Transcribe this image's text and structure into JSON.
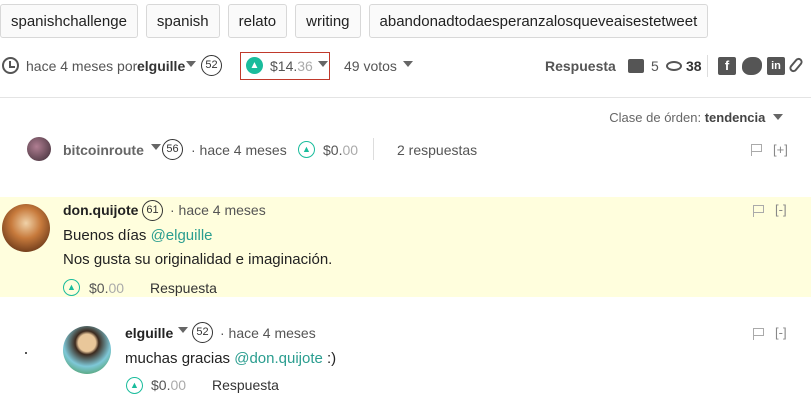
{
  "tags": [
    "spanishchallenge",
    "spanish",
    "relato",
    "writing",
    "abandonadtodaesperanzalosqueveaisestetweet"
  ],
  "post": {
    "time_prefix": "hace 4 meses por",
    "author": "elguille",
    "author_rep": "52",
    "payout_main": "$14.",
    "payout_cents": "36",
    "votes": "49 votos",
    "reply_label": "Respuesta",
    "comment_count": "5",
    "view_count": "38"
  },
  "sort": {
    "label": "Clase de órden:",
    "value": "tendencia"
  },
  "comments": [
    {
      "author": "bitcoinroute",
      "rep": "56",
      "time": "· hace 4 meses",
      "payout_main": "$0.",
      "payout_cents": "00",
      "replies": "2 respuestas",
      "toggle": "[+]"
    },
    {
      "author": "don.quijote",
      "rep": "61",
      "time": "· hace 4 meses",
      "line1_prefix": "Buenos días ",
      "line1_mention": "@elguille",
      "line2": "Nos gusta su originalidad e imaginación.",
      "payout_main": "$0.",
      "payout_cents": "00",
      "reply_label": "Respuesta",
      "toggle": "[-]"
    },
    {
      "author": "elguille",
      "rep": "52",
      "time": "· hace 4 meses",
      "line1_prefix": "muchas gracias ",
      "line1_mention": "@don.quijote",
      "line1_suffix": " :)",
      "payout_main": "$0.",
      "payout_cents": "00",
      "reply_label": "Respuesta",
      "toggle": "[-]"
    }
  ],
  "colors": {
    "upvote": "#1abc9c",
    "highlight": "#fffedd",
    "mention": "#2a9d8f",
    "payout_border": "#c0392b"
  }
}
